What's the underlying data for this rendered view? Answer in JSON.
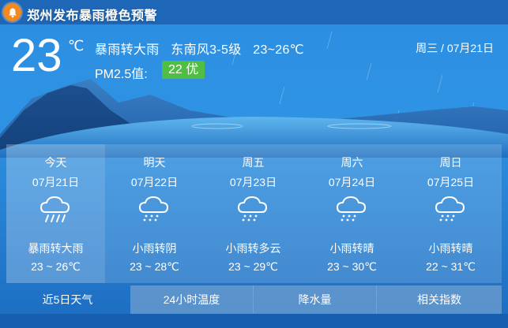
{
  "alert": {
    "text": "郑州发布暴雨橙色预警",
    "icon": "bell-icon",
    "color": "#f28a1f"
  },
  "current": {
    "temp": "23",
    "unit": "℃",
    "condition": "暴雨转大雨",
    "wind": "东南风3-5级",
    "range": "23~26℃",
    "pm_label": "PM2.5值:",
    "pm_value": "22 优",
    "pm_color": "#4fbe43",
    "date": "周三 / 07月21日"
  },
  "forecast": [
    {
      "name": "今天",
      "date": "07月21日",
      "condition": "暴雨转大雨",
      "range": "23 ~ 26℃",
      "icon": "heavy-rain-icon"
    },
    {
      "name": "明天",
      "date": "07月22日",
      "condition": "小雨转阴",
      "range": "23 ~ 28℃",
      "icon": "light-rain-icon"
    },
    {
      "name": "周五",
      "date": "07月23日",
      "condition": "小雨转多云",
      "range": "23 ~ 29℃",
      "icon": "light-rain-icon"
    },
    {
      "name": "周六",
      "date": "07月24日",
      "condition": "小雨转晴",
      "range": "23 ~ 30℃",
      "icon": "light-rain-icon"
    },
    {
      "name": "周日",
      "date": "07月25日",
      "condition": "小雨转晴",
      "range": "22 ~ 31℃",
      "icon": "light-rain-icon"
    }
  ],
  "tabs": [
    {
      "label": "近5日天气",
      "active": true
    },
    {
      "label": "24小时温度",
      "active": false
    },
    {
      "label": "降水量",
      "active": false
    },
    {
      "label": "相关指数",
      "active": false
    }
  ]
}
